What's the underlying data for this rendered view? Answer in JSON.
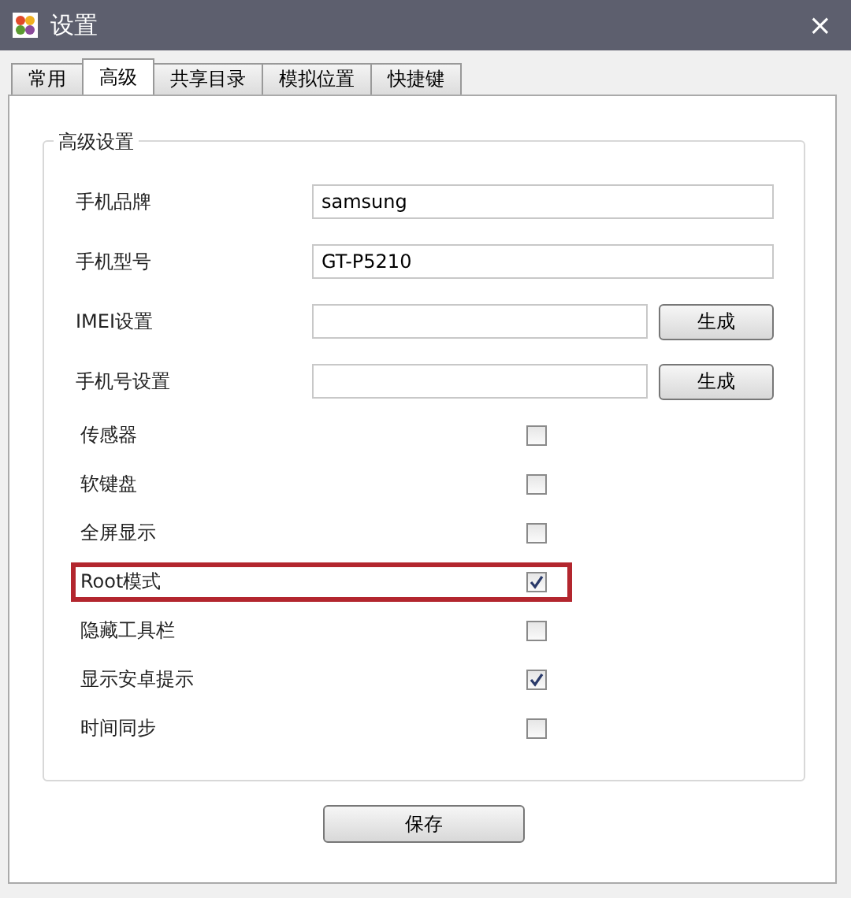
{
  "window": {
    "title": "设置",
    "close": "×"
  },
  "tabs": [
    {
      "label": "常用",
      "selected": false
    },
    {
      "label": "高级",
      "selected": true
    },
    {
      "label": "共享目录",
      "selected": false
    },
    {
      "label": "模拟位置",
      "selected": false
    },
    {
      "label": "快捷键",
      "selected": false
    }
  ],
  "group": {
    "title": "高级设置",
    "items": [
      {
        "kind": "field",
        "label": "手机品牌",
        "value": "samsung"
      },
      {
        "kind": "field",
        "label": "手机型号",
        "value": "GT-P5210"
      },
      {
        "kind": "field_button",
        "label": "IMEI设置",
        "button": "生成"
      },
      {
        "kind": "field_button",
        "label": "手机号设置",
        "button": "生成"
      },
      {
        "kind": "checkbox",
        "label": "传感器",
        "checked": false,
        "highlighted": false
      },
      {
        "kind": "checkbox",
        "label": "软键盘",
        "checked": false,
        "highlighted": false
      },
      {
        "kind": "checkbox",
        "label": "全屏显示",
        "checked": false,
        "highlighted": false
      },
      {
        "kind": "checkbox",
        "label": "Root模式",
        "checked": true,
        "highlighted": true
      },
      {
        "kind": "checkbox",
        "label": "隐藏工具栏",
        "checked": false,
        "highlighted": false
      },
      {
        "kind": "checkbox",
        "label": "显示安卓提示",
        "checked": true,
        "highlighted": false
      },
      {
        "kind": "checkbox",
        "label": "时间同步",
        "checked": false,
        "highlighted": false
      }
    ]
  },
  "save_button": "保存"
}
